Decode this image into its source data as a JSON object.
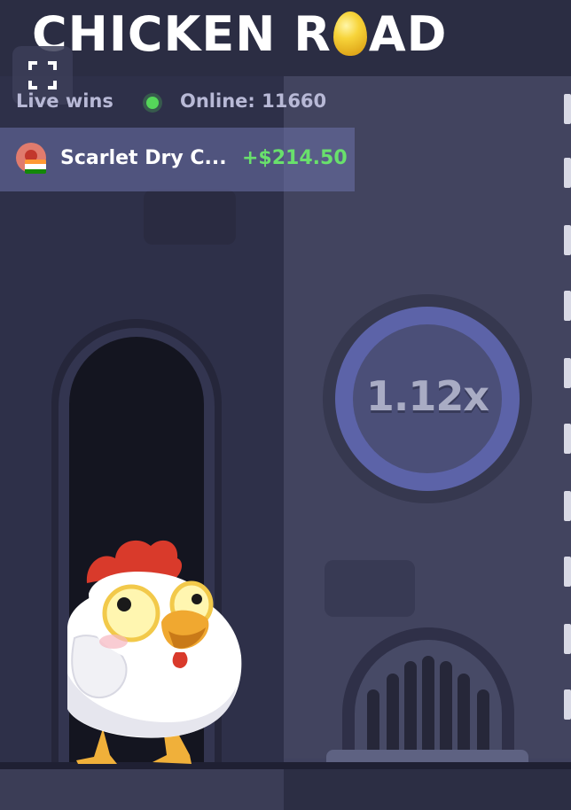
{
  "game": {
    "title_part1": "CHICKEN R",
    "title_part2": "AD",
    "multiplier": "1.12x"
  },
  "live": {
    "label": "Live wins",
    "online": "Online: 11660",
    "win": {
      "name": "Scarlet Dry C...",
      "amount": "+$214.50",
      "flag": "India"
    }
  },
  "colors": {
    "online_dot": "#55d65a",
    "win_amount": "#69e06c",
    "coin_ring": "#5c63a8"
  },
  "icons": [
    "fullscreen-icon",
    "egg-icon",
    "online-status-dot",
    "player-avatar",
    "india-flag-icon"
  ]
}
